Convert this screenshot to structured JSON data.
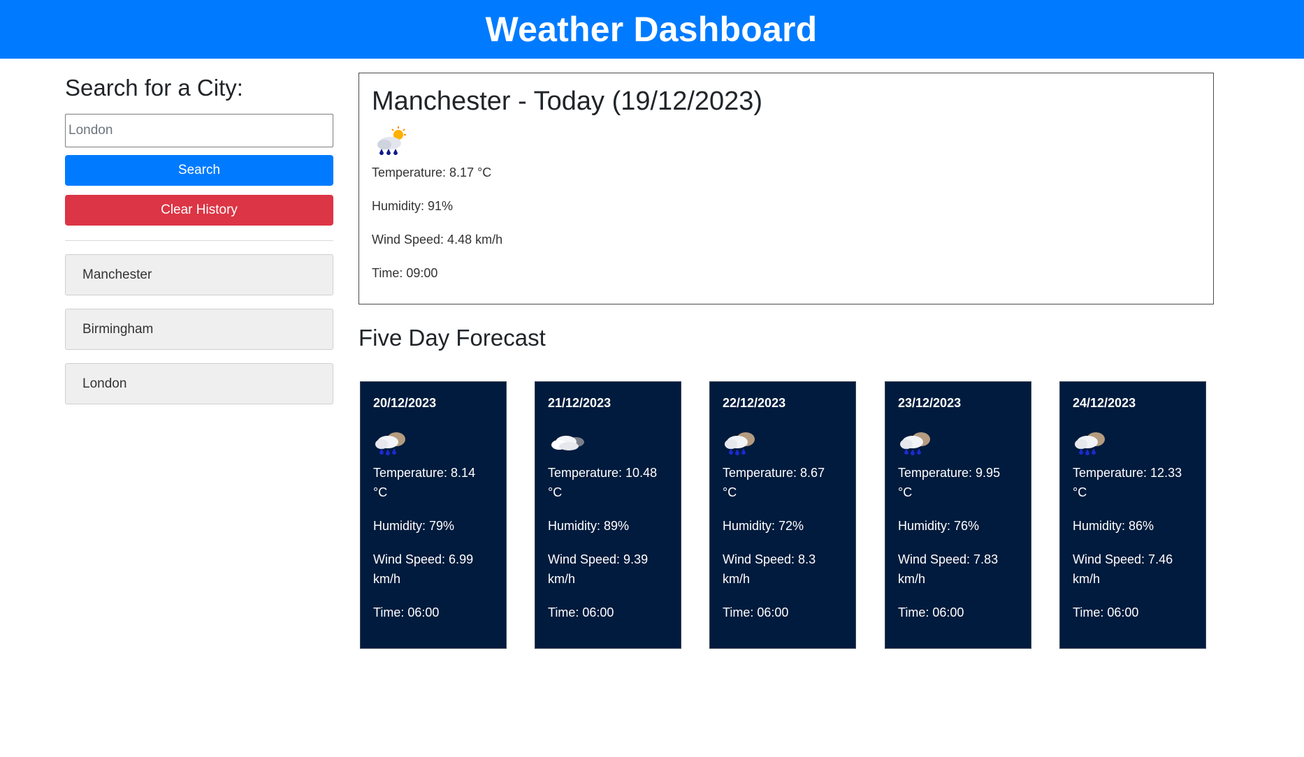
{
  "header": {
    "title": "Weather Dashboard"
  },
  "sidebar": {
    "heading": "Search for a City:",
    "search_placeholder": "London",
    "search_label": "Search",
    "clear_label": "Clear History",
    "history": [
      "Manchester",
      "Birmingham",
      "London"
    ]
  },
  "today": {
    "title": "Manchester - Today (19/12/2023)",
    "icon": "rain-sun-icon",
    "temperature": "Temperature: 8.17 °C",
    "humidity": "Humidity: 91%",
    "wind": "Wind Speed: 4.48 km/h",
    "time": "Time: 09:00"
  },
  "forecast": {
    "title": "Five Day Forecast",
    "days": [
      {
        "date": "20/12/2023",
        "icon": "rain-cloud-icon",
        "temp_line1": "Temperature: 8.14",
        "temp_line2": "°C",
        "humidity": "Humidity: 79%",
        "wind_line1": "Wind Speed: 6.99",
        "wind_line2": "km/h",
        "time": "Time: 06:00"
      },
      {
        "date": "21/12/2023",
        "icon": "cloud-icon",
        "temp_line1": "Temperature: 10.48",
        "temp_line2": "°C",
        "humidity": "Humidity: 89%",
        "wind_line1": "Wind Speed: 9.39",
        "wind_line2": "km/h",
        "time": "Time: 06:00"
      },
      {
        "date": "22/12/2023",
        "icon": "rain-cloud-icon",
        "temp_line1": "Temperature: 8.67",
        "temp_line2": "°C",
        "humidity": "Humidity: 72%",
        "wind_line1": "Wind Speed: 8.3",
        "wind_line2": "km/h",
        "time": "Time: 06:00"
      },
      {
        "date": "23/12/2023",
        "icon": "rain-cloud-icon",
        "temp_line1": "Temperature: 9.95",
        "temp_line2": "°C",
        "humidity": "Humidity: 76%",
        "wind_line1": "Wind Speed: 7.83",
        "wind_line2": "km/h",
        "time": "Time: 06:00"
      },
      {
        "date": "24/12/2023",
        "icon": "rain-cloud-icon",
        "temp_line1": "Temperature: 12.33",
        "temp_line2": "°C",
        "humidity": "Humidity: 86%",
        "wind_line1": "Wind Speed: 7.46",
        "wind_line2": "km/h",
        "time": "Time: 06:00"
      }
    ]
  },
  "colors": {
    "header": "#007bff",
    "search_button": "#007bff",
    "clear_button": "#dc3545",
    "card_background": "#001b3d"
  }
}
